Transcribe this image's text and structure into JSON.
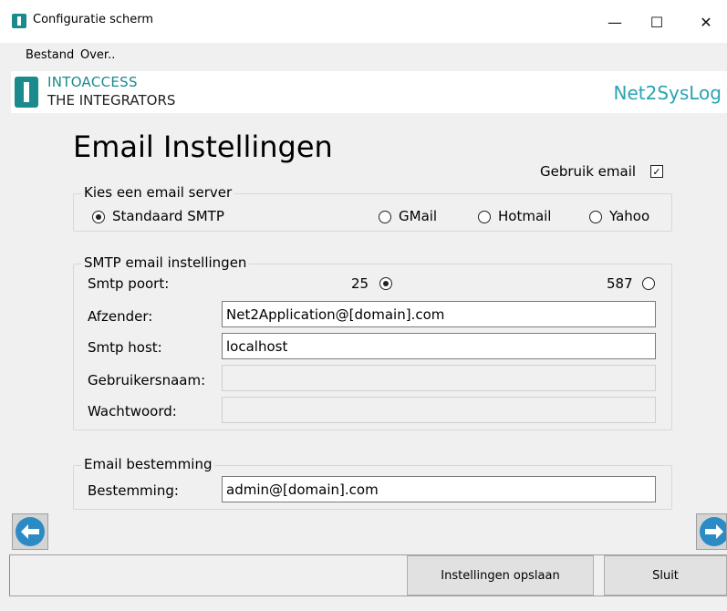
{
  "window": {
    "title": "Configuratie scherm"
  },
  "menu": {
    "items": [
      "Bestand",
      "Over.."
    ]
  },
  "banner": {
    "brand_line1": "INTOACCESS",
    "brand_line2": "THE INTEGRATORS",
    "product": "Net2SysLog"
  },
  "page": {
    "title": "Email Instellingen"
  },
  "use_email": {
    "label": "Gebruik email",
    "checked": true
  },
  "server_group": {
    "legend": "Kies een email server",
    "options": [
      "Standaard SMTP",
      "GMail",
      "Hotmail",
      "Yahoo"
    ],
    "selected": "Standaard SMTP"
  },
  "smtp_group": {
    "legend": "SMTP email instellingen",
    "port_label": "Smtp poort:",
    "port_options": [
      "25",
      "587"
    ],
    "port_selected": "25",
    "sender_label": "Afzender:",
    "sender_value": "Net2Application@[domain].com",
    "host_label": "Smtp host:",
    "host_value": "localhost",
    "username_label": "Gebruikersnaam:",
    "username_value": "",
    "password_label": "Wachtwoord:",
    "password_value": ""
  },
  "dest_group": {
    "legend": "Email bestemming",
    "dest_label": "Bestemming:",
    "dest_value": "admin@[domain].com"
  },
  "buttons": {
    "save": "Instellingen opslaan",
    "close": "Sluit"
  },
  "icons": {
    "back": "arrow-left-circle-icon",
    "next": "arrow-right-circle-icon"
  },
  "colors": {
    "brand": "#1a8a8c",
    "product": "#2aa3b4",
    "nav": "#2c8bc5"
  }
}
